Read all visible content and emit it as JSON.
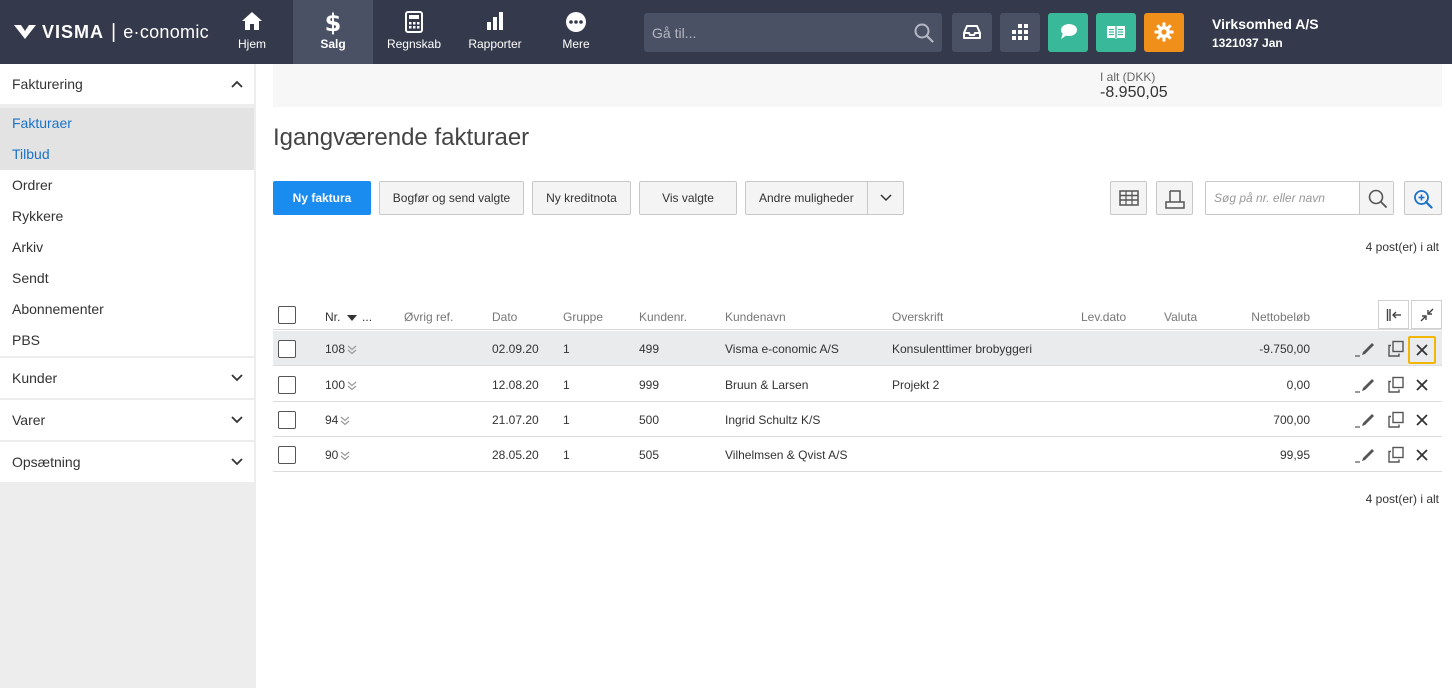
{
  "brand": {
    "name": "VISMA",
    "product": "e·conomic",
    "sep": "|"
  },
  "nav": [
    {
      "label": "Hjem",
      "icon": "home-icon"
    },
    {
      "label": "Salg",
      "icon": "dollar-icon",
      "active": true
    },
    {
      "label": "Regnskab",
      "icon": "calculator-icon"
    },
    {
      "label": "Rapporter",
      "icon": "bar-chart-icon"
    },
    {
      "label": "Mere",
      "icon": "more-dots-icon"
    }
  ],
  "search": {
    "placeholder": "Gå til..."
  },
  "toolbar_colors": {
    "dark": "#4b5165",
    "teal": "#3ab89a",
    "orange": "#f0901b"
  },
  "company": {
    "name": "Virksomhed A/S",
    "user": "1321037 Jan"
  },
  "sidebar": {
    "sections": [
      {
        "label": "Fakturering",
        "expanded": true
      },
      {
        "label": "Kunder"
      },
      {
        "label": "Varer"
      },
      {
        "label": "Opsætning"
      }
    ],
    "items": [
      {
        "label": "Fakturaer",
        "selected": true
      },
      {
        "label": "Tilbud",
        "selected": true
      },
      {
        "label": "Ordrer"
      },
      {
        "label": "Rykkere"
      },
      {
        "label": "Arkiv"
      },
      {
        "label": "Sendt"
      },
      {
        "label": "Abonnementer"
      },
      {
        "label": "PBS"
      }
    ]
  },
  "summary": {
    "label": "I alt (DKK)",
    "value": "-8.950,05"
  },
  "page": {
    "title": "Igangværende fakturaer"
  },
  "actions": {
    "new_invoice": "Ny faktura",
    "book_send": "Bogfør og send valgte",
    "new_credit": "Ny kreditnota",
    "show_selected": "Vis valgte",
    "other_options": "Andre muligheder"
  },
  "table_search": {
    "placeholder": "Søg på nr. eller navn"
  },
  "count_text": "4 post(er) i alt",
  "table": {
    "headers": {
      "nr": "Nr.",
      "nr_more": "...",
      "other_ref": "Øvrig ref.",
      "date": "Dato",
      "group": "Gruppe",
      "customer_no": "Kundenr.",
      "customer_name": "Kundenavn",
      "heading": "Overskrift",
      "delivery_date": "Lev.dato",
      "currency": "Valuta",
      "net_amount": "Nettobeløb"
    },
    "rows": [
      {
        "nr": "108",
        "other_ref": "",
        "date": "02.09.20",
        "group": "1",
        "customer_no": "499",
        "customer_name": "Visma e-conomic A/S",
        "heading": "Konsulenttimer brobyggeri",
        "delivery_date": "",
        "currency": "",
        "net_amount": "-9.750,00",
        "highlighted": true
      },
      {
        "nr": "100",
        "other_ref": "",
        "date": "12.08.20",
        "group": "1",
        "customer_no": "999",
        "customer_name": "Bruun & Larsen",
        "heading": "Projekt 2",
        "delivery_date": "",
        "currency": "",
        "net_amount": "0,00"
      },
      {
        "nr": "94",
        "other_ref": "",
        "date": "21.07.20",
        "group": "1",
        "customer_no": "500",
        "customer_name": "Ingrid Schultz K/S",
        "heading": "",
        "delivery_date": "",
        "currency": "",
        "net_amount": "700,00"
      },
      {
        "nr": "90",
        "other_ref": "",
        "date": "28.05.20",
        "group": "1",
        "customer_no": "505",
        "customer_name": "Vilhelmsen & Qvist A/S",
        "heading": "",
        "delivery_date": "",
        "currency": "",
        "net_amount": "99,95"
      }
    ]
  }
}
